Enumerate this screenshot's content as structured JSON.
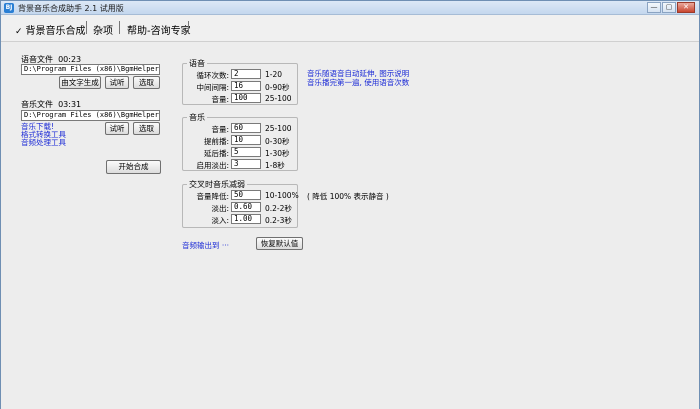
{
  "window": {
    "title": "背景音乐合成助手 2.1 试用版",
    "icon_label": "BJ",
    "buttons": {
      "minimize": "—",
      "maximize": "▢",
      "close": "✕"
    }
  },
  "menu": {
    "tabs": [
      {
        "label": "背景音乐合成",
        "checked": true
      },
      {
        "label": "杂项"
      },
      {
        "label": "帮助-咨询专家"
      }
    ]
  },
  "voice_file": {
    "label": "语音文件",
    "duration": "00:23",
    "path": "D:\\Program Files (x86)\\BgmHelper\\mu:",
    "buttons": {
      "generate": "由文字生成",
      "listen": "试听",
      "select": "选取"
    }
  },
  "music_file": {
    "label": "音乐文件",
    "duration": "03:31",
    "path": "D:\\Program Files (x86)\\BgmHelper\\mu:",
    "buttons": {
      "listen": "试听",
      "select": "选取"
    },
    "links": [
      "音乐下载!",
      "格式转换工具",
      "音频处理工具"
    ]
  },
  "start_button": "开始合成",
  "voice_group": {
    "title": "语音",
    "fields": [
      {
        "label": "循环次数:",
        "value": "2",
        "range": "1-20"
      },
      {
        "label": "中间间隔:",
        "value": "16",
        "range": "0-90秒"
      },
      {
        "label": "音量:",
        "value": "100",
        "range": "25-100"
      }
    ],
    "notes": [
      "音乐随语音自动延伸, 图示说明",
      "音乐播完第一遍, 使用语音次数"
    ]
  },
  "music_group": {
    "title": "音乐",
    "fields": [
      {
        "label": "音量:",
        "value": "60",
        "range": "25-100"
      },
      {
        "label": "提前播:",
        "value": "10",
        "range": "0-30秒"
      },
      {
        "label": "延后播:",
        "value": "5",
        "range": "1-30秒"
      },
      {
        "label": "启用淡出:",
        "value": "3",
        "range": "1-8秒"
      }
    ]
  },
  "cross_group": {
    "title": "交叉时音乐减弱",
    "fields": [
      {
        "label": "音量降低:",
        "value": "50",
        "range": "10-100%"
      },
      {
        "label": "淡出:",
        "value": "0.60",
        "range": "0.2-2秒"
      },
      {
        "label": "淡入:",
        "value": "1.00",
        "range": "0.2-3秒"
      }
    ],
    "note": "( 降低 100% 表示静音 )"
  },
  "output_link": "音频输出到 ···",
  "reset_button": "恢复默认值"
}
